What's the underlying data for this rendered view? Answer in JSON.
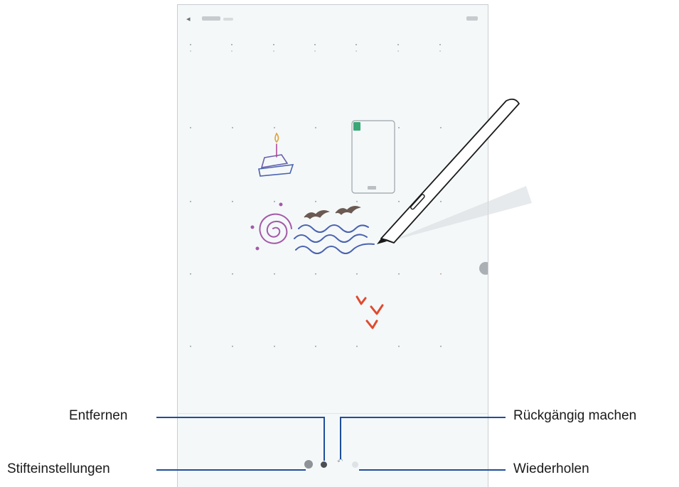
{
  "callouts": {
    "erase": "Entfernen",
    "pen_settings": "Stifteinstellungen",
    "undo": "Rückgängig machen",
    "redo": "Wiederholen"
  },
  "icons": {
    "back": "arrow-left-icon",
    "pen_settings": "pen-settings-icon",
    "erase": "eraser-icon",
    "undo": "undo-icon",
    "redo": "redo-icon"
  },
  "colors": {
    "callout_line": "#1f4e9a",
    "sketch_purple": "#7e63b8",
    "sketch_blue": "#4a63b0",
    "sketch_brown": "#6b5a52",
    "sketch_red": "#e04a2e",
    "sticky_green": "#3aa776"
  }
}
